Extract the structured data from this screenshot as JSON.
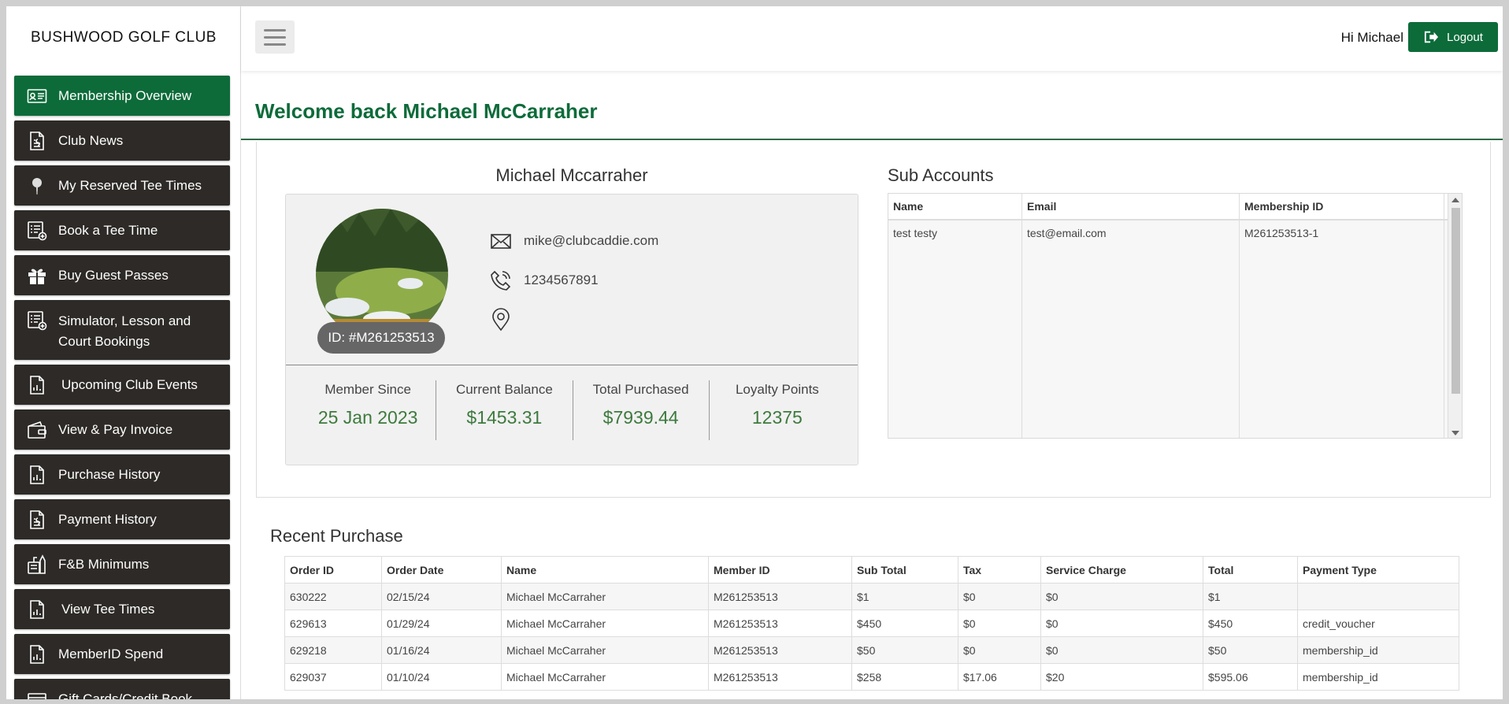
{
  "brand": "BUSHWOOD GOLF CLUB",
  "sidebar": {
    "items": [
      {
        "label": "Membership Overview",
        "icon": "id-card-icon"
      },
      {
        "label": "Club News",
        "icon": "document-icon"
      },
      {
        "label": "My Reserved Tee Times",
        "icon": "golf-tee-icon"
      },
      {
        "label": "Book a Tee Time",
        "icon": "list-add-icon"
      },
      {
        "label": "Buy Guest Passes",
        "icon": "gift-icon"
      },
      {
        "label": "Simulator, Lesson and Court Bookings",
        "icon": "list-add-icon"
      },
      {
        "label": "Upcoming Club Events",
        "icon": "report-icon"
      },
      {
        "label": "View & Pay Invoice",
        "icon": "wallet-icon"
      },
      {
        "label": "Purchase History",
        "icon": "report-icon"
      },
      {
        "label": "Payment History",
        "icon": "document-icon"
      },
      {
        "label": "F&B Minimums",
        "icon": "food-icon"
      },
      {
        "label": "View Tee Times",
        "icon": "report-icon"
      },
      {
        "label": "MemberID Spend",
        "icon": "report-icon"
      },
      {
        "label": "Gift Cards/Credit Book",
        "icon": "gift-card-icon"
      }
    ]
  },
  "header": {
    "greeting": "Hi Michael",
    "logout_label": "Logout"
  },
  "welcome": "Welcome back Michael McCarraher",
  "profile": {
    "name": "Michael Mccarraher",
    "id_label": "ID: #M261253513",
    "email": "mike@clubcaddie.com",
    "phone": "1234567891",
    "stats": [
      {
        "label": "Member Since",
        "value": "25 Jan 2023"
      },
      {
        "label": "Current Balance",
        "value": "$1453.31"
      },
      {
        "label": "Total Purchased",
        "value": "$7939.44"
      },
      {
        "label": "Loyalty Points",
        "value": "12375"
      }
    ]
  },
  "sub_accounts": {
    "title": "Sub Accounts",
    "columns": [
      "Name",
      "Email",
      "Membership ID"
    ],
    "rows": [
      [
        "test testy",
        "test@email.com",
        "M261253513-1"
      ]
    ]
  },
  "recent_purchase": {
    "title": "Recent Purchase",
    "columns": [
      "Order ID",
      "Order Date",
      "Name",
      "Member ID",
      "Sub Total",
      "Tax",
      "Service Charge",
      "Total",
      "Payment Type"
    ],
    "rows": [
      [
        "630222",
        "02/15/24",
        "Michael McCarraher",
        "M261253513",
        "$1",
        "$0",
        "$0",
        "$1",
        ""
      ],
      [
        "629613",
        "01/29/24",
        "Michael McCarraher",
        "M261253513",
        "$450",
        "$0",
        "$0",
        "$450",
        "credit_voucher"
      ],
      [
        "629218",
        "01/16/24",
        "Michael McCarraher",
        "M261253513",
        "$50",
        "$0",
        "$0",
        "$50",
        "membership_id"
      ],
      [
        "629037",
        "01/10/24",
        "Michael McCarraher",
        "M261253513",
        "$258",
        "$17.06",
        "$20",
        "$595.06",
        "membership_id"
      ]
    ]
  },
  "colors": {
    "accent": "#0d6b3a",
    "nav_bg": "#2d2a27",
    "stat_value": "#3d7a3d"
  }
}
